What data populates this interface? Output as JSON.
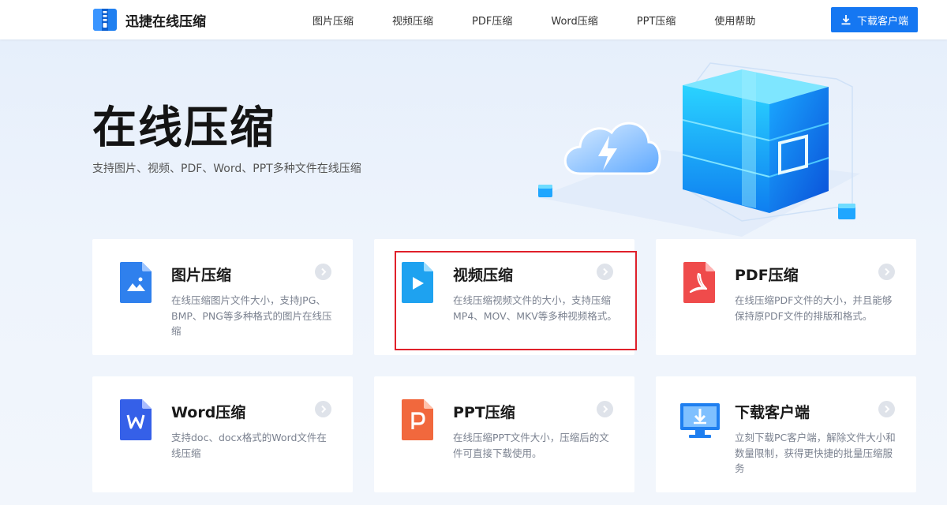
{
  "header": {
    "logo_text": "迅捷在线压缩",
    "nav": [
      "图片压缩",
      "视频压缩",
      "PDF压缩",
      "Word压缩",
      "PPT压缩",
      "使用帮助"
    ],
    "download_label": "下载客户端"
  },
  "hero": {
    "title": "在线压缩",
    "subtitle": "支持图片、视频、PDF、Word、PPT多种文件在线压缩"
  },
  "cards": [
    {
      "title": "图片压缩",
      "desc": "在线压缩图片文件大小，支持JPG、BMP、PNG等多种格式的图片在线压缩",
      "icon": "image-file-icon",
      "color": "#2f80ed"
    },
    {
      "title": "视频压缩",
      "desc": "在线压缩视频文件的大小，支持压缩MP4、MOV、MKV等多种视频格式。",
      "icon": "video-file-icon",
      "color": "#1ea2f0"
    },
    {
      "title": "PDF压缩",
      "desc": "在线压缩PDF文件的大小，并且能够保持原PDF文件的排版和格式。",
      "icon": "pdf-file-icon",
      "color": "#ef4b4b"
    },
    {
      "title": "Word压缩",
      "desc": "支持doc、docx格式的Word文件在线压缩",
      "icon": "word-file-icon",
      "color": "#3560e8"
    },
    {
      "title": "PPT压缩",
      "desc": "在线压缩PPT文件大小，压缩后的文件可直接下载使用。",
      "icon": "ppt-file-icon",
      "color": "#f1683d"
    },
    {
      "title": "下载客户端",
      "desc": "立刻下载PC客户端，解除文件大小和数量限制，获得更快捷的批量压缩服务",
      "icon": "monitor-download-icon",
      "color": "#1f7ff0"
    }
  ],
  "colors": {
    "accent": "#1577f2",
    "highlight_border": "#e0202a"
  }
}
